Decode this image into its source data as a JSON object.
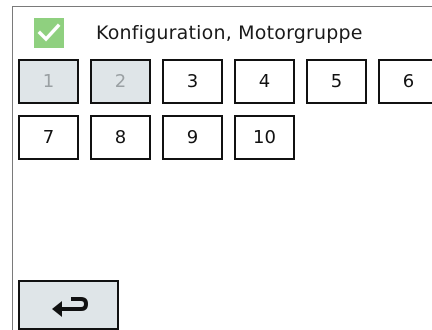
{
  "header": {
    "title": "Konfiguration, Motorgruppe",
    "icon": "checkmark-icon"
  },
  "groups": [
    {
      "label": "1",
      "state": "inactive"
    },
    {
      "label": "2",
      "state": "inactive"
    },
    {
      "label": "3",
      "state": "active"
    },
    {
      "label": "4",
      "state": "active"
    },
    {
      "label": "5",
      "state": "active"
    },
    {
      "label": "6",
      "state": "active"
    },
    {
      "label": "7",
      "state": "active"
    },
    {
      "label": "8",
      "state": "active"
    },
    {
      "label": "9",
      "state": "active"
    },
    {
      "label": "10",
      "state": "active"
    }
  ],
  "footer": {
    "back_icon": "return-arrow-icon"
  },
  "colors": {
    "check_bg": "#8fd07f",
    "inactive_bg": "#dfe5e8",
    "inactive_text": "#9aa0a3",
    "border": "#111111"
  }
}
